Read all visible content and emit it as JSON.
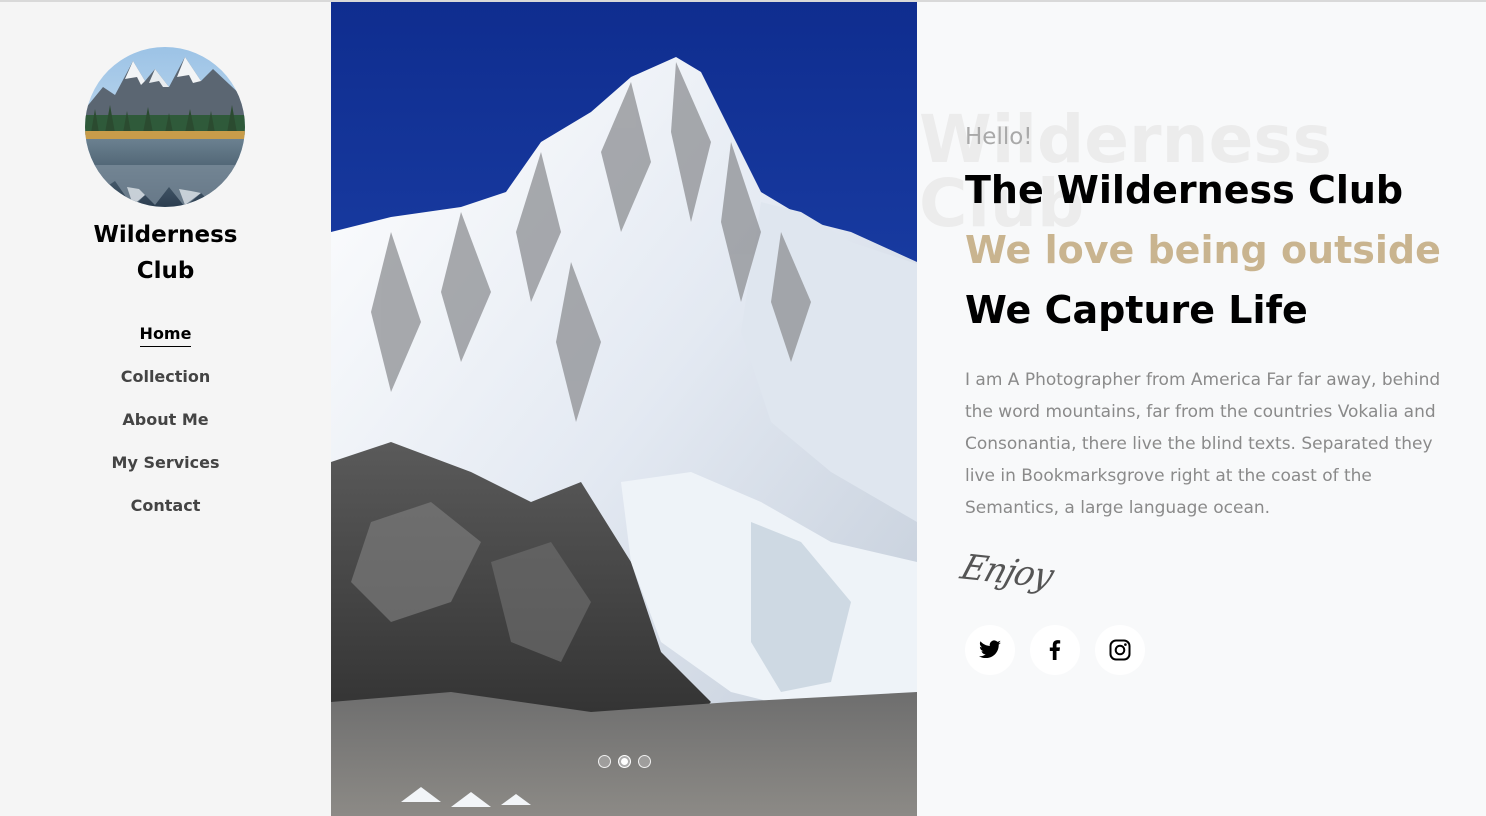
{
  "sidebar": {
    "avatar_icon": "mountain-lake-avatar",
    "brand_line1": "Wilderness",
    "brand_line2": "Club",
    "nav": [
      {
        "label": "Home",
        "active": true
      },
      {
        "label": "Collection",
        "active": false
      },
      {
        "label": "About Me",
        "active": false
      },
      {
        "label": "My Services",
        "active": false
      },
      {
        "label": "Contact",
        "active": false
      }
    ]
  },
  "hero": {
    "image_icon": "snowy-mountain-photo",
    "slides": 3,
    "active_slide": 2
  },
  "content": {
    "watermark_line1": "Wilderness",
    "watermark_line2": "Club",
    "hello": "Hello!",
    "title": "The Wilderness Club",
    "accent": "We love being outside",
    "tagline": "We Capture Life",
    "paragraph": "I am A Photographer from America Far far away, behind the word mountains, far from the countries Vokalia and Consonantia, there live the blind texts. Separated they live in Bookmarksgrove right at the coast of the Semantics, a large language ocean.",
    "signature": "Enjoy",
    "socials": [
      {
        "name": "twitter-icon"
      },
      {
        "name": "facebook-icon"
      },
      {
        "name": "instagram-icon"
      }
    ]
  },
  "colors": {
    "accent": "#c9b48f",
    "sidebar_bg": "#f5f5f5",
    "content_bg": "#f8f9fa",
    "paragraph": "#8a8a8a"
  }
}
